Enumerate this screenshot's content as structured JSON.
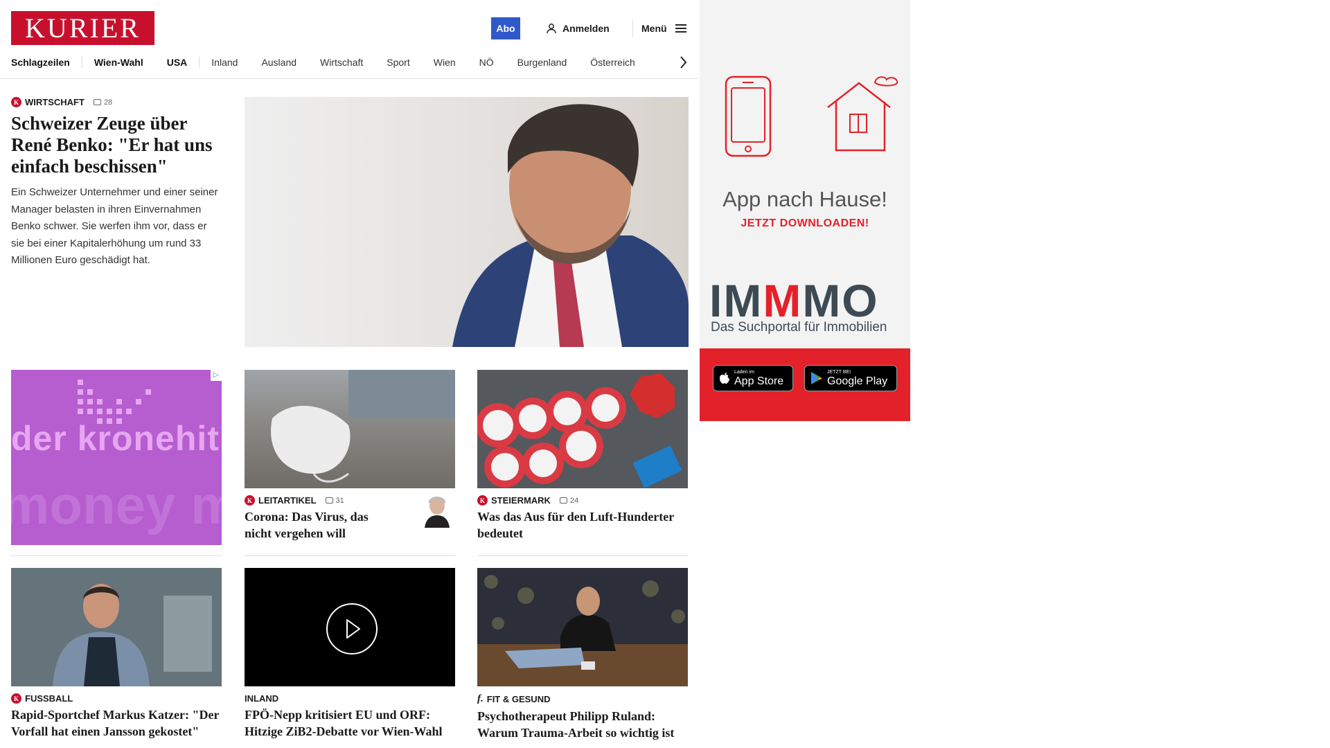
{
  "header": {
    "logo": "KURIER",
    "abo_label": "Abo",
    "login_label": "Anmelden",
    "menu_label": "Menü"
  },
  "nav": {
    "items": [
      "Schlagzeilen",
      "Wien-Wahl",
      "USA",
      "Inland",
      "Ausland",
      "Wirtschaft",
      "Sport",
      "Wien",
      "NÖ",
      "Burgenland",
      "Österreich"
    ]
  },
  "lead": {
    "category": "WIRTSCHAFT",
    "comments": "28",
    "headline": "Schweizer Zeuge über René Benko: \"Er hat uns einfach beschissen\"",
    "teaser": "Ein Schweizer Unternehmer und einer seiner Manager belasten in ihren Einvernahmen Benko schwer. Sie werfen ihm vor, dass er sie bei einer Kapitalerhöhung um rund 33 Millionen Euro geschädigt hat."
  },
  "ad_kronehit": {
    "text": "der kronehit",
    "bg_text": "money m"
  },
  "cards": [
    {
      "category": "LEITARTIKEL",
      "comments": "31",
      "headline": "Corona: Das Virus, das nicht vergehen will"
    },
    {
      "category": "STEIERMARK",
      "comments": "24",
      "headline": "Was das Aus für den Luft-Hunderter bedeutet"
    },
    {
      "category": "FUSSBALL",
      "headline": "Rapid-Sportchef Markus Katzer: \"Der Vorfall hat einen Jansson gekostet\""
    },
    {
      "category": "INLAND",
      "headline": "FPÖ-Nepp kritisiert EU und ORF: Hitzige ZiB2-Debatte vor Wien-Wahl"
    },
    {
      "category": "FIT & GESUND",
      "headline": "Psychotherapeut Philipp Ruland: Warum Trauma-Arbeit so wichtig ist"
    }
  ],
  "side_ad": {
    "title": "App nach Hause!",
    "cta": "JETZT DOWNLOADEN!",
    "brand_pre": "IM",
    "brand_m": "M",
    "brand_post": "MO",
    "subtitle": "Das Suchportal für Immobilien",
    "appstore_small": "Laden im",
    "appstore_big": "App Store",
    "googleplay_small": "JETZT BEI",
    "googleplay_big": "Google Play"
  },
  "colors": {
    "brand_red": "#c8102e",
    "abo_blue": "#2f59c9",
    "immmo_red": "#e3212a"
  }
}
